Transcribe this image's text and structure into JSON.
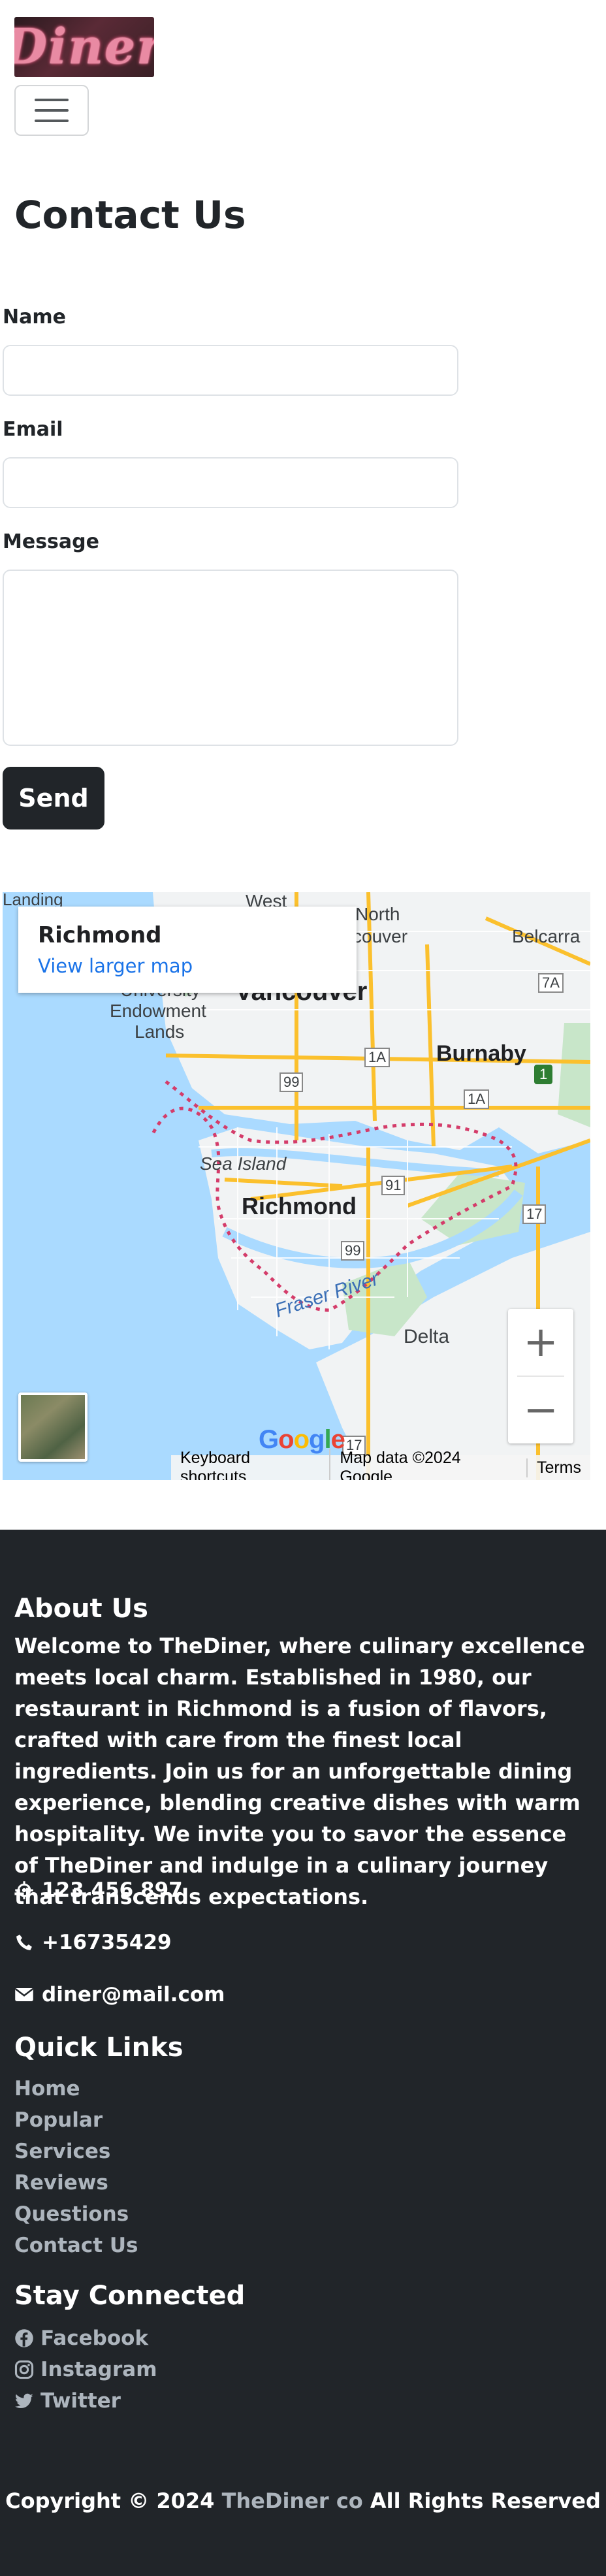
{
  "header": {
    "logo_text": "Diner",
    "menu_toggle_label": "Toggle navigation"
  },
  "contact": {
    "title": "Contact Us",
    "name_label": "Name",
    "email_label": "Email",
    "message_label": "Message",
    "send_label": "Send"
  },
  "map": {
    "place_name": "Richmond",
    "larger_map_link": "View larger map",
    "zoom_in": "+",
    "zoom_out": "−",
    "google_logo": "Google",
    "attribution": {
      "shortcuts": "Keyboard shortcuts",
      "data": "Map data ©2024 Google",
      "terms": "Terms"
    },
    "labels": {
      "landing": "Landing",
      "west": "West",
      "north": "North",
      "vancouver_short": "couver",
      "belcarra": "Belcarra",
      "university": "University",
      "endowment": "Endowment",
      "lands": "Lands",
      "vancouver": "Vancouver",
      "burnaby": "Burnaby",
      "sea_island": "Sea Island",
      "richmond": "Richmond",
      "fraser_river": "Fraser River",
      "delta": "Delta",
      "route_7a": "7A",
      "route_1a": "1A",
      "route_1a_b": "1A",
      "route_99": "99",
      "route_99_b": "99",
      "route_91": "91",
      "route_17": "17",
      "route_17_b": "17",
      "route_1": "1"
    },
    "colors": {
      "water": "#aadaff",
      "land": "#f1f3f4",
      "park": "#c8e6c9",
      "road": "#fbc02d",
      "boundary": "#d43c6a"
    }
  },
  "footer": {
    "about_title": "About Us",
    "about_text": "Welcome to TheDiner, where culinary excellence meets local charm. Established in 1980, our restaurant in Richmond is a fusion of flavors, crafted with care from the finest local ingredients. Join us for an unforgettable dining experience, blending creative dishes with warm hospitality. We invite you to savor the essence of TheDiner and indulge in a culinary journey that transcends expectations.",
    "address": "123 456 897",
    "phone": "+16735429",
    "email": "diner@mail.com",
    "quick_links_title": "Quick Links",
    "quick_links": [
      "Home",
      "Popular",
      "Services",
      "Reviews",
      "Questions",
      "Contact Us"
    ],
    "stay_connected_title": "Stay Connected",
    "socials": [
      "Facebook",
      "Instagram",
      "Twitter"
    ],
    "copyright_prefix": "Copyright © 2024",
    "copyright_brand": "TheDiner co",
    "copyright_suffix": "All Rights Reserved"
  }
}
